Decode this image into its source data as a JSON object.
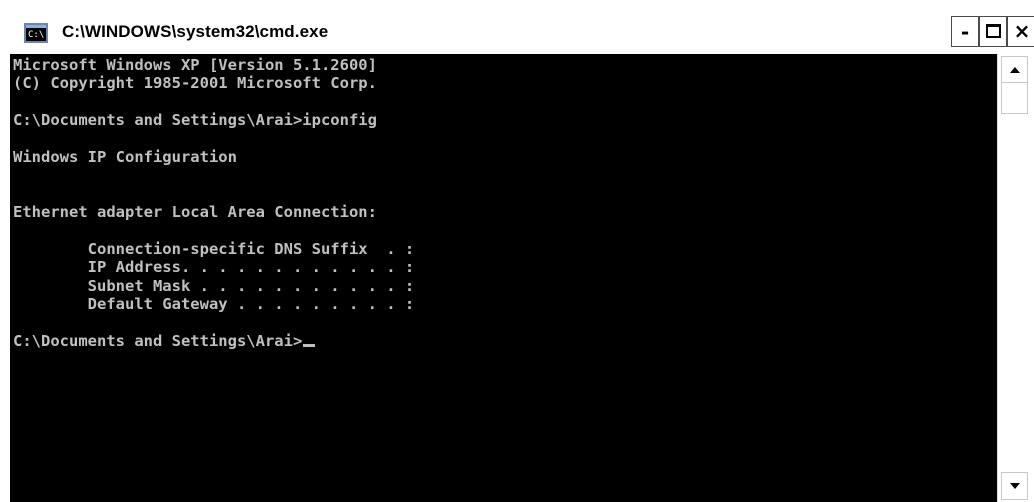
{
  "window": {
    "title": "C:\\WINDOWS\\system32\\cmd.exe",
    "icon": "command-prompt-icon",
    "icon_text": "C:\\",
    "controls": {
      "minimize_label": "-",
      "maximize_icon": "maximize-icon",
      "close_label": "×"
    }
  },
  "console": {
    "background_color": "#000000",
    "text_color": "#c0c0c0",
    "lines": [
      "Microsoft Windows XP [Version 5.1.2600]",
      "(C) Copyright 1985-2001 Microsoft Corp.",
      "",
      "C:\\Documents and Settings\\Arai>ipconfig",
      "",
      "Windows IP Configuration",
      "",
      "",
      "Ethernet adapter Local Area Connection:",
      "",
      "        Connection-specific DNS Suffix  . :",
      "        IP Address. . . . . . . . . . . . :",
      "        Subnet Mask . . . . . . . . . . . :",
      "        Default Gateway . . . . . . . . . :",
      "",
      "C:\\Documents and Settings\\Arai>"
    ]
  },
  "scrollbar": {
    "up_icon": "scroll-up-arrow-icon",
    "down_icon": "scroll-down-arrow-icon"
  }
}
